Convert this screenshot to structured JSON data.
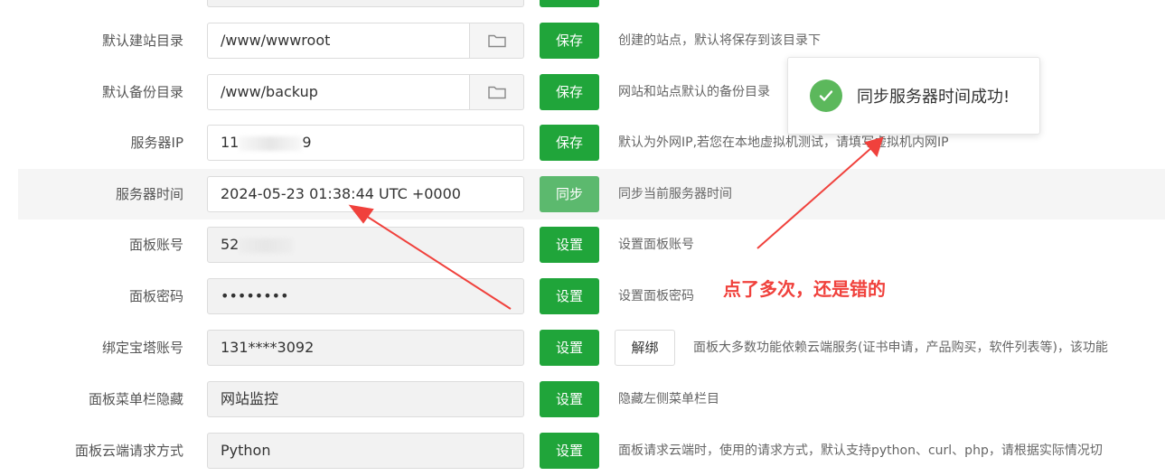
{
  "rows": [
    {
      "label": "默认建站目录",
      "value": "/www/wwwroot",
      "button": "保存",
      "desc": "创建的站点，默认将保存到该目录下",
      "icon": "folder-icon"
    },
    {
      "label": "默认备份目录",
      "value": "/www/backup",
      "button": "保存",
      "desc": "网站和站点默认的备份目录",
      "icon": "folder-icon"
    },
    {
      "label": "服务器IP",
      "value_prefix": "11",
      "value_suffix": "9",
      "button": "保存",
      "desc": "默认为外网IP,若您在本地虚拟机测试，请填写虚拟机内网IP"
    },
    {
      "label": "服务器时间",
      "value": "2024-05-23 01:38:44 UTC +0000",
      "button": "同步",
      "desc": "同步当前服务器时间"
    },
    {
      "label": "面板账号",
      "value_prefix": "52",
      "button": "设置",
      "desc": "设置面板账号"
    },
    {
      "label": "面板密码",
      "value": "••••••••",
      "button": "设置",
      "desc": "设置面板密码"
    },
    {
      "label": "绑定宝塔账号",
      "value": "131****3092",
      "button": "设置",
      "unbind": "解绑",
      "desc": "面板大多数功能依赖云端服务(证书申请，产品购买，软件列表等)，该功能"
    },
    {
      "label": "面板菜单栏隐藏",
      "value": "网站监控",
      "button": "设置",
      "desc": "隐藏左侧菜单栏目"
    },
    {
      "label": "面板云端请求方式",
      "value": "Python",
      "button": "设置",
      "desc": "面板请求云端时，使用的请求方式，默认支持python、curl、php，请根据实际情况切"
    }
  ],
  "toast": {
    "message": "同步服务器时间成功!",
    "icon": "check-circle-icon"
  },
  "annotation": {
    "text": "点了多次，还是错的"
  },
  "colors": {
    "primary": "#20a53a",
    "primary_light": "#5cb96e",
    "annotation": "#f0413c",
    "success": "#5cb85c"
  }
}
